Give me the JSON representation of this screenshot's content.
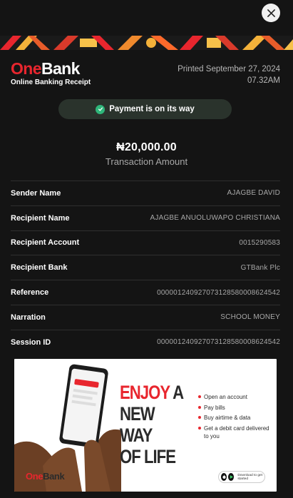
{
  "close": {
    "icon": "close-icon"
  },
  "header": {
    "logo_one": "One",
    "logo_bank": "Bank",
    "subtitle": "Online Banking Receipt",
    "printed_line1": "Printed September 27, 2024",
    "printed_line2": "07.32AM"
  },
  "status": {
    "icon": "check-circle-icon",
    "text": "Payment is on its way"
  },
  "amount": {
    "value": "₦20,000.00",
    "label": "Transaction Amount"
  },
  "details": [
    {
      "label": "Sender Name",
      "value": "AJAGBE DAVID"
    },
    {
      "label": "Recipient Name",
      "value": "AJAGBE ANUOLUWAPO CHRISTIANA"
    },
    {
      "label": "Recipient Account",
      "value": "0015290583"
    },
    {
      "label": "Recipient Bank",
      "value": "GTBank Plc"
    },
    {
      "label": "Reference",
      "value": "000001240927073128580008624542"
    },
    {
      "label": "Narration",
      "value": "SCHOOL MONEY"
    },
    {
      "label": "Session ID",
      "value": "000001240927073128580008624542"
    }
  ],
  "ad": {
    "headline_red": "ENJOY",
    "headline_rest1": " A",
    "headline_rest2": "NEW WAY",
    "headline_rest3": "OF LIFE",
    "bullets": [
      "Open an account",
      "Pay bills",
      "Buy airtime & data",
      "Get a debit card delivered to you"
    ],
    "logo_one": "One",
    "logo_bank": "Bank",
    "store_text": "Download to get started"
  },
  "colors": {
    "brand_red": "#e8262e",
    "success_green": "#2fb67a",
    "background": "#141414"
  }
}
